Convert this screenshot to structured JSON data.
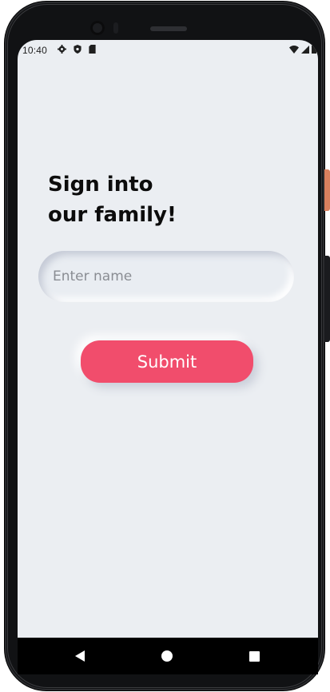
{
  "status_bar": {
    "time": "10:40",
    "icons_left": [
      "gear-icon",
      "shield-icon",
      "sd-card-icon"
    ],
    "icons_right": [
      "wifi-icon",
      "signal-icon",
      "battery-icon"
    ]
  },
  "form": {
    "heading_line1": "Sign into",
    "heading_line2": "our family!",
    "name_placeholder": "Enter name",
    "name_value": "",
    "submit_label": "Submit"
  },
  "nav_bar": {
    "buttons": [
      "back-icon",
      "home-icon",
      "recents-icon"
    ]
  },
  "colors": {
    "background": "#ebeef2",
    "accent": "#f14d6c",
    "heading_text": "#0c0c0c"
  }
}
